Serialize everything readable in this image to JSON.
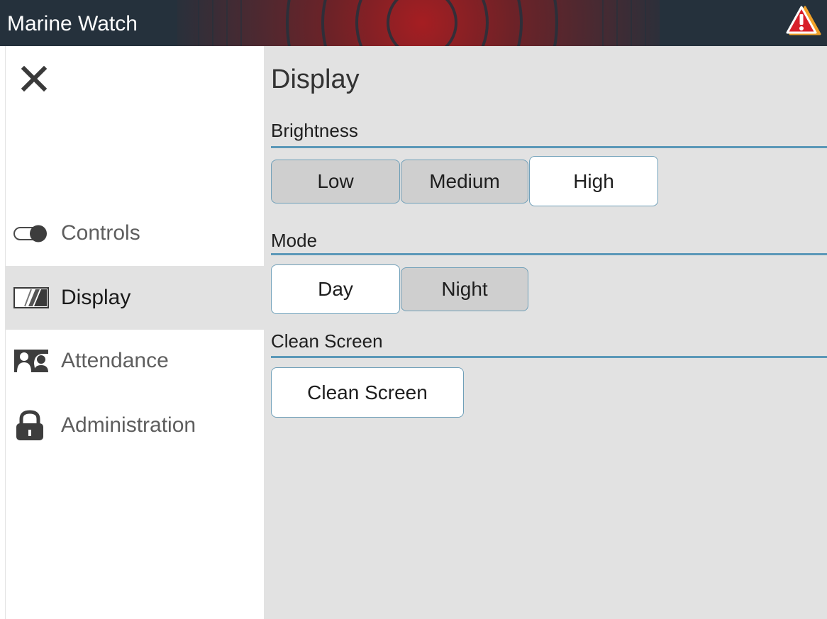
{
  "app": {
    "title": "Marine Watch",
    "alert_icon": "warning-triangle-icon"
  },
  "sidebar": {
    "close_icon": "close-icon",
    "items": [
      {
        "label": "Controls",
        "icon": "toggle-icon",
        "active": false
      },
      {
        "label": "Display",
        "icon": "display-icon",
        "active": true
      },
      {
        "label": "Attendance",
        "icon": "attendance-icon",
        "active": false
      },
      {
        "label": "Administration",
        "icon": "lock-icon",
        "active": false
      }
    ]
  },
  "main": {
    "title": "Display",
    "brightness": {
      "label": "Brightness",
      "options": [
        "Low",
        "Medium",
        "High"
      ],
      "selected": "High"
    },
    "mode": {
      "label": "Mode",
      "options": [
        "Day",
        "Night"
      ],
      "selected": "Day"
    },
    "clean": {
      "label": "Clean Screen",
      "button": "Clean Screen"
    }
  },
  "colors": {
    "titlebar": "#25313c",
    "accent_rule": "#5b98b8",
    "panel_bg": "#e2e2e2",
    "alert_red": "#d8202a",
    "alert_orange": "#f2a229"
  }
}
